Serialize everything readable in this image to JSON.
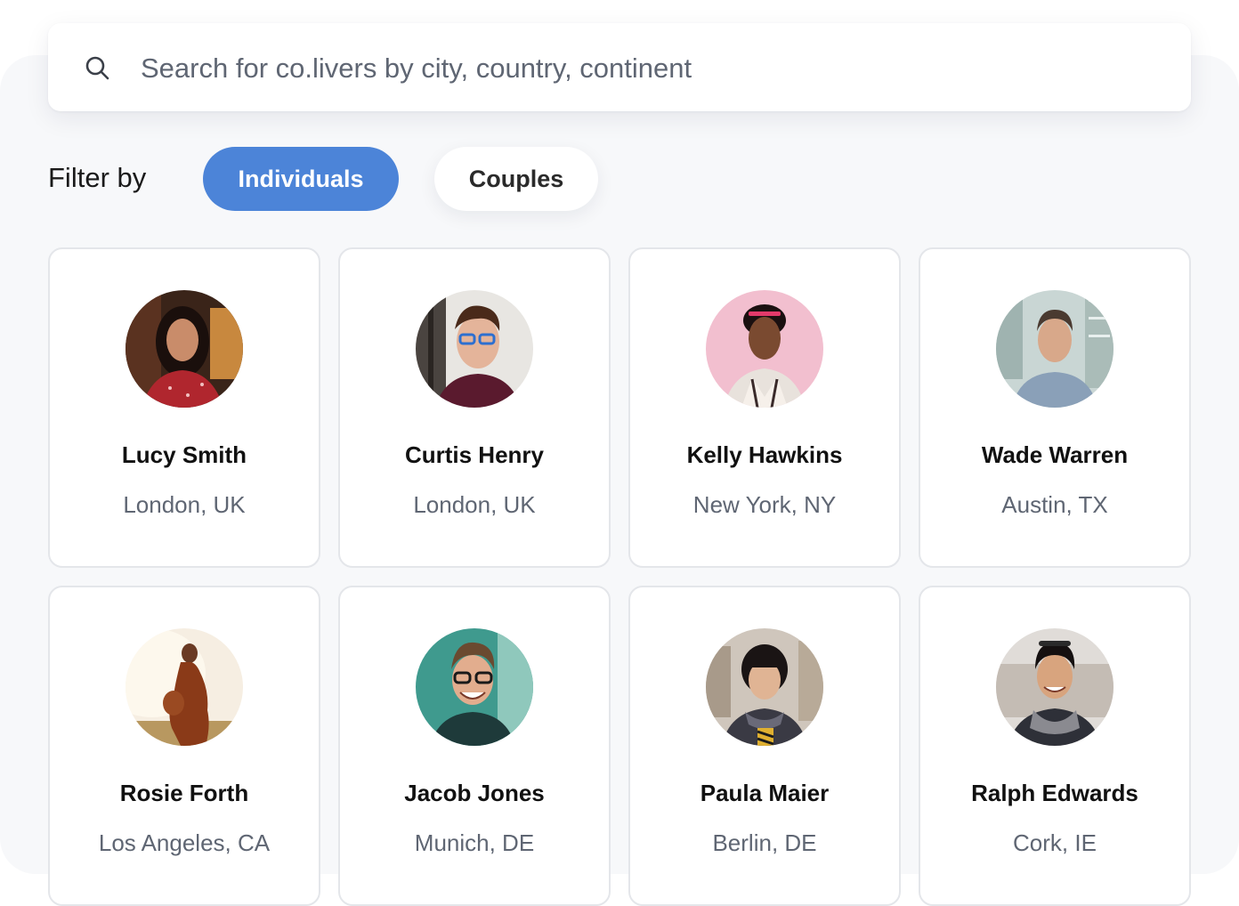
{
  "search": {
    "placeholder": "Search for co.livers by city, country, continent",
    "icon": "search-icon"
  },
  "filter": {
    "label": "Filter by",
    "options": [
      {
        "label": "Individuals",
        "selected": true
      },
      {
        "label": "Couples",
        "selected": false
      }
    ]
  },
  "colors": {
    "accent": "#4c84d8",
    "background": "#f7f8fa",
    "secondary_text": "#5f6673"
  },
  "people": [
    {
      "name": "Lucy Smith",
      "location": "London, UK"
    },
    {
      "name": "Curtis Henry",
      "location": "London, UK"
    },
    {
      "name": "Kelly Hawkins",
      "location": "New York, NY"
    },
    {
      "name": "Wade Warren",
      "location": "Austin, TX"
    },
    {
      "name": "Rosie Forth",
      "location": "Los Angeles, CA"
    },
    {
      "name": "Jacob Jones",
      "location": "Munich, DE"
    },
    {
      "name": "Paula Maier",
      "location": "Berlin, DE"
    },
    {
      "name": "Ralph Edwards",
      "location": "Cork, IE"
    }
  ]
}
